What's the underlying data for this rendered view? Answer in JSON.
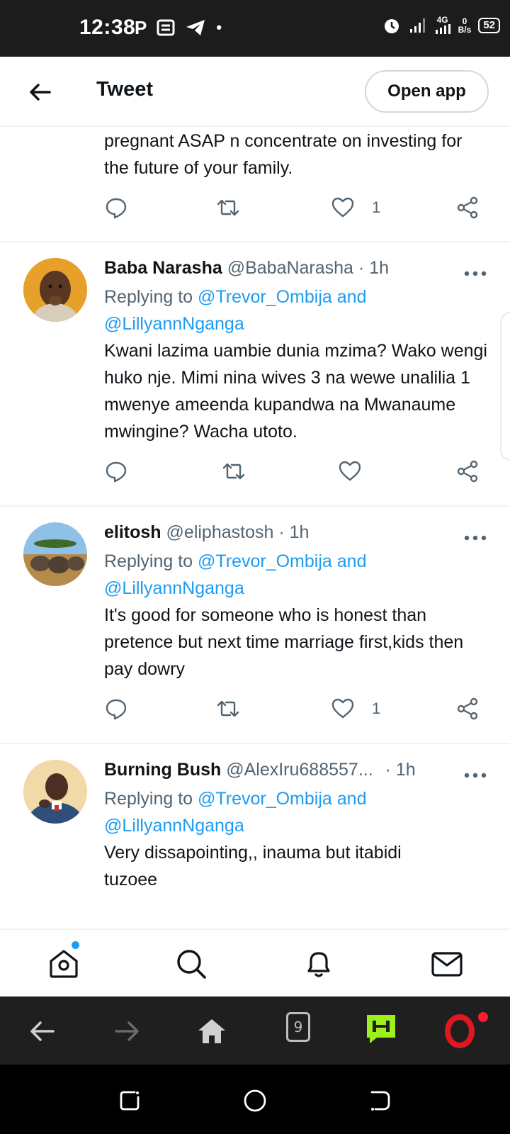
{
  "status_bar": {
    "time": "12:38",
    "network": "4G",
    "speed_value": "0",
    "speed_unit": "B/s",
    "battery": "52"
  },
  "header": {
    "title": "Tweet",
    "open_app_label": "Open app"
  },
  "partial_tweet": {
    "text": "pregnant ASAP n concentrate on investing for the future of your family.",
    "likes": "1"
  },
  "tweets": [
    {
      "name": "Baba Narasha",
      "handle": "@BabaNarasha",
      "dot": "·",
      "time": "1h",
      "replying_prefix": "Replying to ",
      "mention1": "@Trevor_Ombija",
      "and": " and",
      "mention2": "@LillyannNganga",
      "text": "Kwani lazima uambie dunia mzima? Wako wengi huko nje. Mimi nina wives 3 na wewe unalilia 1 mwenye ameenda kupandwa na Mwanaume mwingine? Wacha utoto.",
      "likes": ""
    },
    {
      "name": "elitosh",
      "handle": "@eliphastosh",
      "dot": "·",
      "time": "1h",
      "replying_prefix": "Replying to ",
      "mention1": "@Trevor_Ombija",
      "and": " and",
      "mention2": "@LillyannNganga",
      "text": "It's good for someone who is honest than pretence but next time marriage first,kids then pay dowry",
      "likes": "1"
    },
    {
      "name": "Burning Bush",
      "handle": "@AlexIru688557...",
      "dot": "·",
      "time": "1h",
      "replying_prefix": "Replying to ",
      "mention1": "@Trevor_Ombija",
      "and": " and",
      "mention2": "@LillyannNganga",
      "text": "Very dissapointing,, inauma but itabidi tuzoee"
    }
  ],
  "browser": {
    "tab_count": "9"
  },
  "colors": {
    "accent": "#1d9bf0",
    "text": "#0f1419",
    "secondary": "#536471",
    "divider": "#eff3f4"
  }
}
